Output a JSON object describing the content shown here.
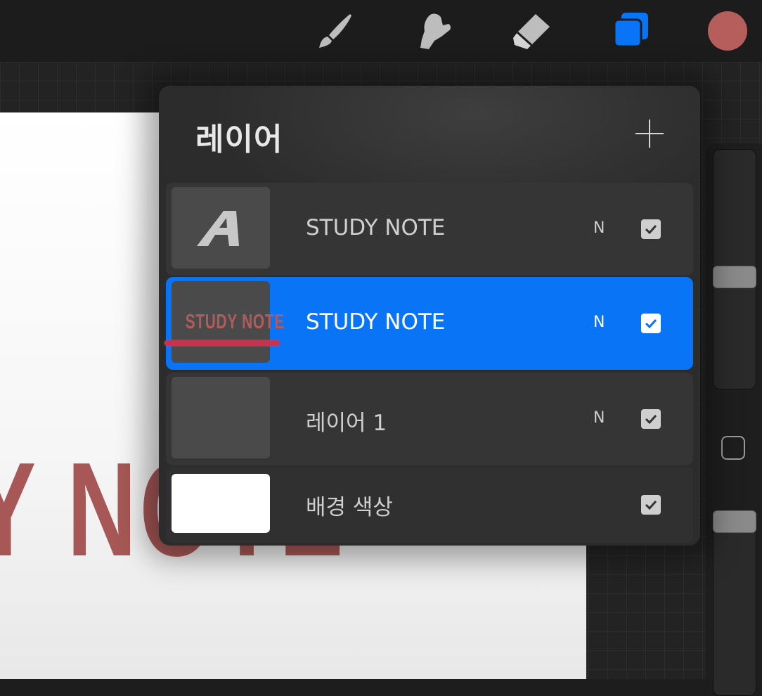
{
  "toolbar": {
    "tools": [
      {
        "name": "brush",
        "icon": "brush-icon"
      },
      {
        "name": "smudge",
        "icon": "smudge-icon"
      },
      {
        "name": "eraser",
        "icon": "eraser-icon"
      },
      {
        "name": "layers",
        "icon": "layers-icon"
      }
    ],
    "current_color": "#b55e5c",
    "accent": "#0a74f7"
  },
  "canvas": {
    "text": "Y NOTE",
    "text_color": "#a75856"
  },
  "layers_panel": {
    "title": "레이어",
    "add_icon": "plus-icon",
    "layers": [
      {
        "name": "STUDY NOTE",
        "blend": "N",
        "visible": true,
        "selected": false,
        "thumb_type": "text-layer",
        "thumb_glyph": "A"
      },
      {
        "name": "STUDY NOTE",
        "blend": "N",
        "visible": true,
        "selected": true,
        "thumb_type": "image",
        "thumb_text": "STUDY NOTE"
      },
      {
        "name": "레이어 1",
        "blend": "N",
        "visible": true,
        "selected": false,
        "thumb_type": "empty"
      },
      {
        "name": "배경 색상",
        "blend": "",
        "visible": true,
        "selected": false,
        "thumb_type": "background",
        "thumb_color": "#ffffff"
      }
    ]
  }
}
